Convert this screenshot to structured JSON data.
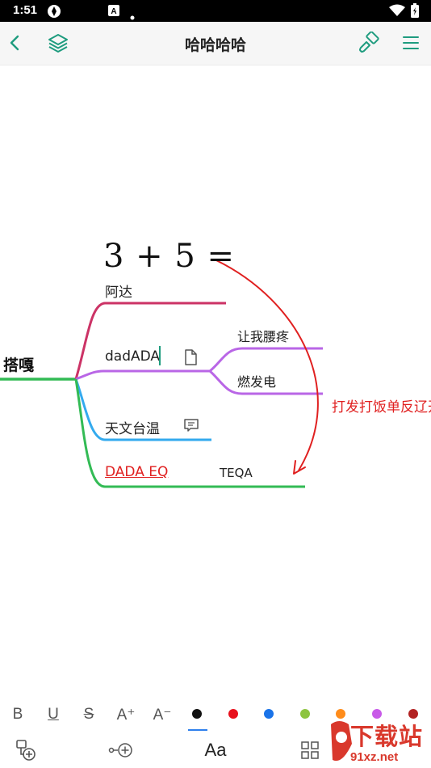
{
  "status_bar": {
    "time": "1:51"
  },
  "toolbar": {
    "title": "哈哈哈哈"
  },
  "mindmap": {
    "formula": "3 + 5 =",
    "root": "搭嘎",
    "branch_1": "阿达",
    "branch_2": "dadADA",
    "branch_2_child_1": "让我腰疼",
    "branch_2_child_2": "燃发电",
    "branch_3": "天文台温",
    "branch_4": "DADA EQ",
    "branch_4_extra": "TEQA",
    "relationship_note": "打发打饭单反辽开"
  },
  "format_bar": {
    "bold": "B",
    "underline": "U",
    "strike": "S",
    "font_up": "A⁺",
    "font_down": "A⁻",
    "colors": [
      "#111111",
      "#e8101c",
      "#1a73e8",
      "#8dc43f",
      "#ff8c1a",
      "#c85ae8",
      "#b22222"
    ]
  },
  "bottom_bar": {
    "text_style": "Aa"
  },
  "watermark": {
    "main": "下载站",
    "sub": "91xz.net"
  },
  "colors": {
    "branch_1": "#cc3366",
    "branch_2": "#b966e6",
    "branch_3": "#33aaee",
    "branch_4": "#33bb55",
    "accent": "#1f9c7f",
    "relationship": "#e02020"
  }
}
